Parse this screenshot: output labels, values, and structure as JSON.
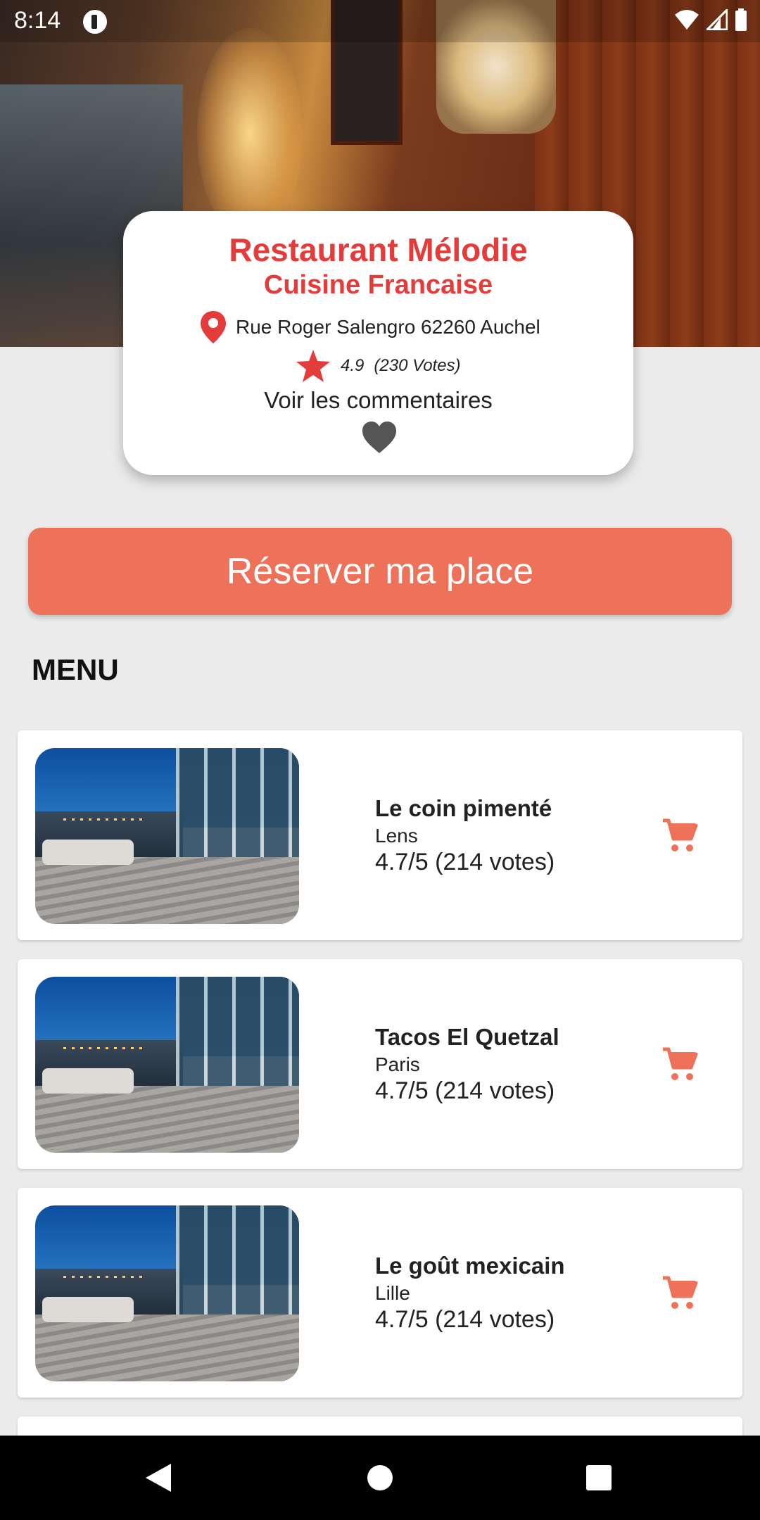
{
  "status": {
    "time": "8:14"
  },
  "restaurant": {
    "name": "Restaurant Mélodie",
    "cuisine": "Cuisine Francaise",
    "address": "Rue Roger Salengro 62260 Auchel",
    "rating": "4.9",
    "votes": "(230 Votes)",
    "comments_link": "Voir les commentaires"
  },
  "actions": {
    "reserve_label": "Réserver ma place"
  },
  "menu": {
    "heading": "MENU",
    "items": [
      {
        "name": "Le coin pimenté",
        "city": "Lens",
        "rating": "4.7/5 (214 votes)"
      },
      {
        "name": "Tacos El Quetzal",
        "city": "Paris",
        "rating": "4.7/5 (214 votes)"
      },
      {
        "name": "Le goût mexicain",
        "city": "Lille",
        "rating": "4.7/5 (214 votes)"
      }
    ]
  },
  "colors": {
    "accent_red": "#e43b3b",
    "button_coral": "#ee715a",
    "background": "#ecebec"
  },
  "icons": {
    "location": "location-pin-icon",
    "star": "star-icon",
    "heart": "heart-icon",
    "cart": "cart-icon"
  }
}
